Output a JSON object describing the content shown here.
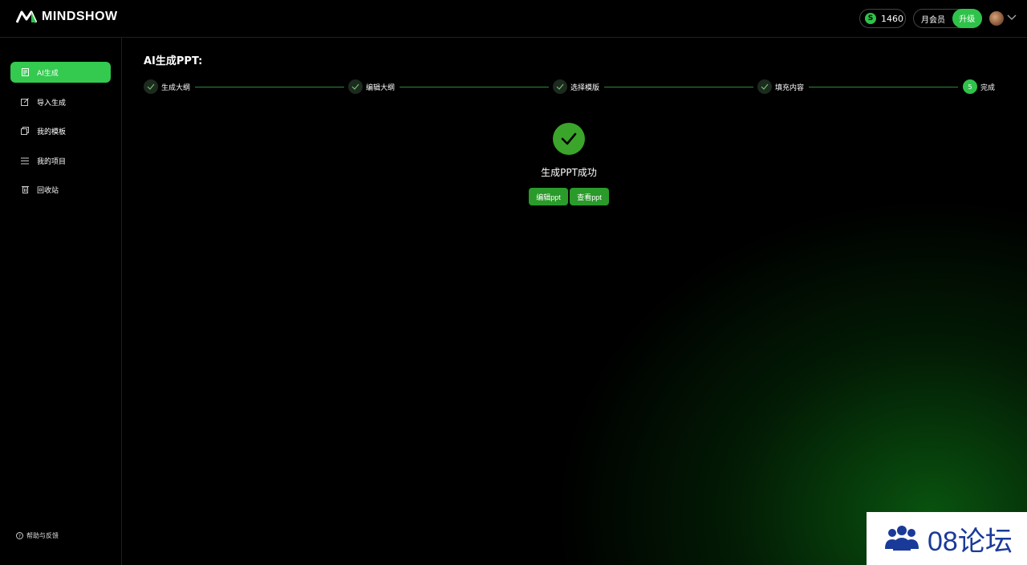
{
  "header": {
    "logo_text": "MINDSHOW",
    "credits_symbol": "S",
    "credits": "1460",
    "member_label": "月会员",
    "upgrade_label": "升级"
  },
  "sidebar": {
    "items": [
      {
        "label": "AI生成",
        "icon": "document-icon",
        "active": true
      },
      {
        "label": "导入生成",
        "icon": "import-icon",
        "active": false
      },
      {
        "label": "我的模板",
        "icon": "template-icon",
        "active": false
      },
      {
        "label": "我的项目",
        "icon": "list-icon",
        "active": false
      },
      {
        "label": "回收站",
        "icon": "trash-icon",
        "active": false
      }
    ],
    "help_label": "帮助与反馈"
  },
  "main": {
    "title": "AI生成PPT:",
    "steps": [
      {
        "label": "生成大纲",
        "status": "done"
      },
      {
        "label": "编辑大纲",
        "status": "done"
      },
      {
        "label": "选择模版",
        "status": "done"
      },
      {
        "label": "填充内容",
        "status": "done"
      },
      {
        "label": "完成",
        "status": "current",
        "number": "5"
      }
    ],
    "success_text": "生成PPT成功",
    "edit_button": "编辑ppt",
    "view_button": "查看ppt"
  },
  "watermark": {
    "text": "08论坛"
  },
  "colors": {
    "accent": "#34c94f",
    "button": "#2a9a2a",
    "success": "#3aa52a",
    "watermark": "#1a3a9a"
  }
}
